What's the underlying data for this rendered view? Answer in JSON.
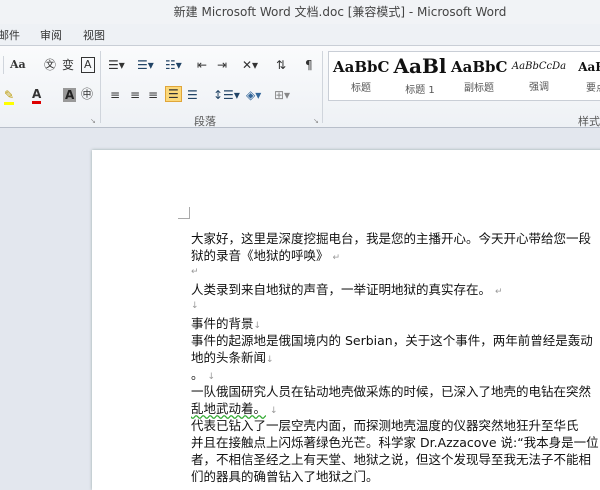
{
  "title": "新建 Microsoft Word 文档.doc [兼容模式] - Microsoft Word",
  "tabs": [
    "邮件",
    "审阅",
    "视图"
  ],
  "ribbon": {
    "paragraph_group": "段落",
    "styles_group": "样式",
    "styles": [
      {
        "sample": "AaBbC",
        "label": "标题"
      },
      {
        "sample": "AaBl",
        "label": "标题 1"
      },
      {
        "sample": "AaBbC",
        "label": "副标题"
      },
      {
        "sample": "AaBbCcDa",
        "label": "强调"
      },
      {
        "sample": "AaBb",
        "label": "要点"
      }
    ],
    "font_size_case": "Aa"
  },
  "document": {
    "lines": [
      "大家好，这里是深度挖掘电台，我是您的主播开心。今天开心带给您一段",
      "狱的录音《地狱的呼唤》",
      "",
      "人类录到来自地狱的声音，一举证明地狱的真实存在。",
      "",
      "事件的背景",
      "事件的起源地是俄国境内的 Serbian，关于这个事件，两年前曾经是轰动",
      "地的头条新闻",
      "。",
      "一队俄国研究人员在钻动地壳做采炼的时候，已深入了地壳的电钻在突然",
      "乱地武动着。",
      "代表已钻入了一层空壳内面，而探测地壳温度的仪器突然地狂升至华氏",
      "并且在接触点上闪烁著绿色光芒。科学家 Dr.Azzacove 说:“我本身是一位",
      "者，不相信圣经之上有天堂、地狱之说，但这个发现导至我无法子不能相",
      "们的器具的确曾钻入了地狱之门。"
    ]
  }
}
